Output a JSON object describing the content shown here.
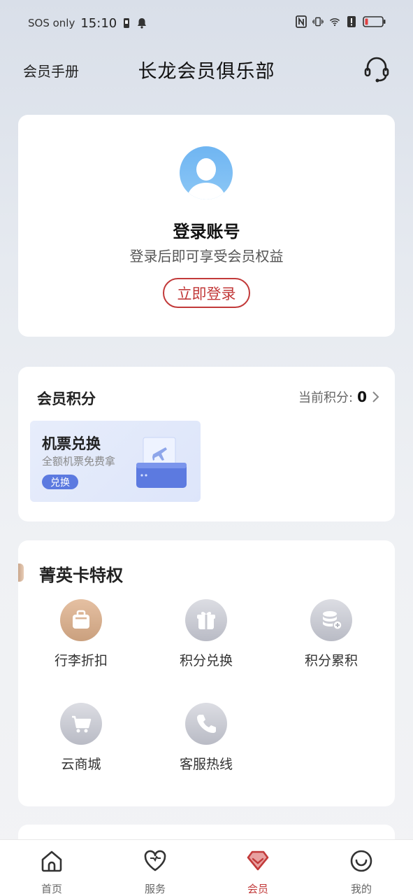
{
  "status_bar": {
    "carrier": "SOS only",
    "time": "15:10"
  },
  "header": {
    "handbook": "会员手册",
    "title": "长龙会员俱乐部",
    "service_icon": "headset-icon"
  },
  "login": {
    "title": "登录账号",
    "subtitle": "登录后即可享受会员权益",
    "button": "立即登录"
  },
  "points": {
    "title": "会员积分",
    "current_label": "当前积分:",
    "current_value": "0",
    "exchange": {
      "title": "机票兑换",
      "subtitle": "全额机票免费拿",
      "badge": "兑换"
    }
  },
  "privileges": {
    "title": "菁英卡特权",
    "items": [
      {
        "label": "行李折扣",
        "icon": "luggage-icon",
        "style": "gold"
      },
      {
        "label": "积分兑换",
        "icon": "gift-icon",
        "style": "gray"
      },
      {
        "label": "积分累积",
        "icon": "coins-icon",
        "style": "gray"
      },
      {
        "label": "云商城",
        "icon": "cart-icon",
        "style": "gray"
      },
      {
        "label": "客服热线",
        "icon": "phone-icon",
        "style": "gray"
      }
    ]
  },
  "nav": {
    "items": [
      {
        "label": "首页",
        "icon": "home-icon"
      },
      {
        "label": "服务",
        "icon": "heart-icon"
      },
      {
        "label": "会员",
        "icon": "member-icon",
        "active": true
      },
      {
        "label": "我的",
        "icon": "smile-icon"
      }
    ]
  },
  "colors": {
    "accent": "#c23a3a",
    "badge_blue": "#5c7ae0",
    "gold": "#caa07e"
  }
}
